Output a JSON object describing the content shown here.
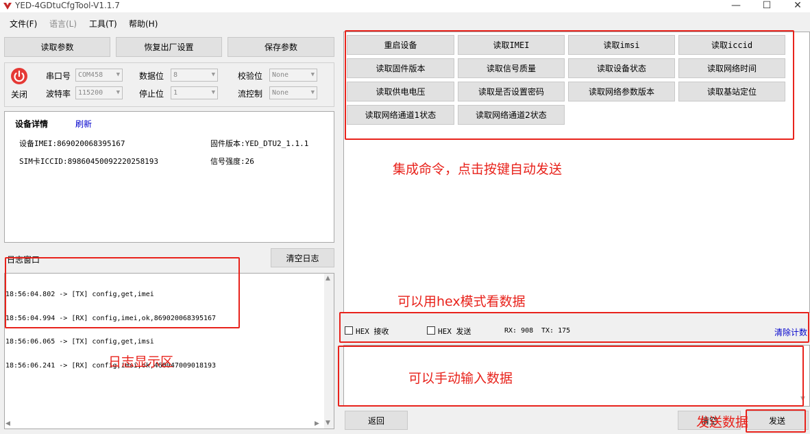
{
  "window": {
    "title": "YED-4GDtuCfgTool-V1.1.7",
    "minimize": "—",
    "maximize": "☐",
    "close": "✕"
  },
  "menu": {
    "file": "文件(F)",
    "language": "语言(L)",
    "tools": "工具(T)",
    "help": "帮助(H)"
  },
  "top_buttons": {
    "read_params": "读取参数",
    "factory_reset": "恢复出厂设置",
    "save_params": "保存参数"
  },
  "serial": {
    "close_label": "关闭",
    "port_label": "串口号",
    "port_value": "COM458",
    "baud_label": "波特率",
    "baud_value": "115200",
    "databits_label": "数据位",
    "databits_value": "8",
    "stopbits_label": "停止位",
    "stopbits_value": "1",
    "parity_label": "校验位",
    "parity_value": "None",
    "flow_label": "流控制",
    "flow_value": "None"
  },
  "device": {
    "title": "设备详情",
    "refresh": "刷新",
    "imei": "设备IMEI:869020068395167",
    "iccid": "SIM卡ICCID:89860450092220258193",
    "firmware": "固件版本:YED_DTU2_1.1.1",
    "signal": "信号强度:26"
  },
  "log": {
    "title": "日志窗口",
    "clear": "清空日志",
    "lines": [
      "18:56:04.802 -> [TX] config,get,imei",
      "18:56:04.994 -> [RX] config,imei,ok,869020068395167",
      "18:56:06.065 -> [TX] config,get,imsi",
      "18:56:06.241 -> [RX] config,imsi,ok,460047009018193"
    ]
  },
  "commands": [
    "重启设备",
    "读取IMEI",
    "读取imsi",
    "读取iccid",
    "读取固件版本",
    "读取信号质量",
    "读取设备状态",
    "读取网络时间",
    "读取供电电压",
    "读取是否设置密码",
    "读取网络参数版本",
    "读取基站定位",
    "读取网络通道1状态",
    "读取网络通道2状态"
  ],
  "options": {
    "hex_recv": "HEX 接收",
    "hex_send": "HEX 发送",
    "rx": "RX: 908",
    "tx": "TX: 175",
    "clear_count": "清除计数"
  },
  "bottom": {
    "back": "返回",
    "clear": "清空",
    "send": "发送"
  },
  "annotations": {
    "commands": "集成命令，点击按键自动发送",
    "hex": "可以用hex模式看数据",
    "manual": "可以手动输入数据",
    "log": "日志显示区",
    "send": "发送数据"
  },
  "colors": {
    "annotation": "#e8221b",
    "power": "#e53935",
    "link": "#0000cc"
  }
}
